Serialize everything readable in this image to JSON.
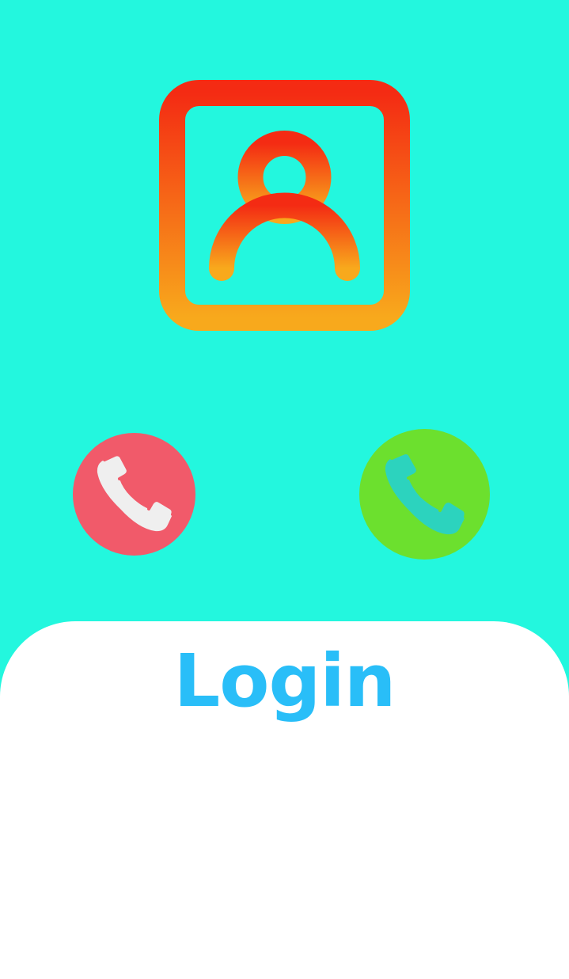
{
  "screen": {
    "background_color": "#23F7DE"
  },
  "contact_icon": {
    "icon": "contact-person-icon",
    "gradient_top": "#F42B13",
    "gradient_bottom": "#F8A91C"
  },
  "call_buttons": {
    "decline": {
      "icon": "phone-icon",
      "color": "#F15A6A",
      "glyph_color": "#EFEFEF"
    },
    "accept": {
      "icon": "phone-icon",
      "color": "#6CE02E",
      "glyph_color": "#2CD3BE"
    }
  },
  "login_panel": {
    "title": "Login",
    "title_color": "#29BEF8",
    "background_color": "#FFFFFF"
  }
}
